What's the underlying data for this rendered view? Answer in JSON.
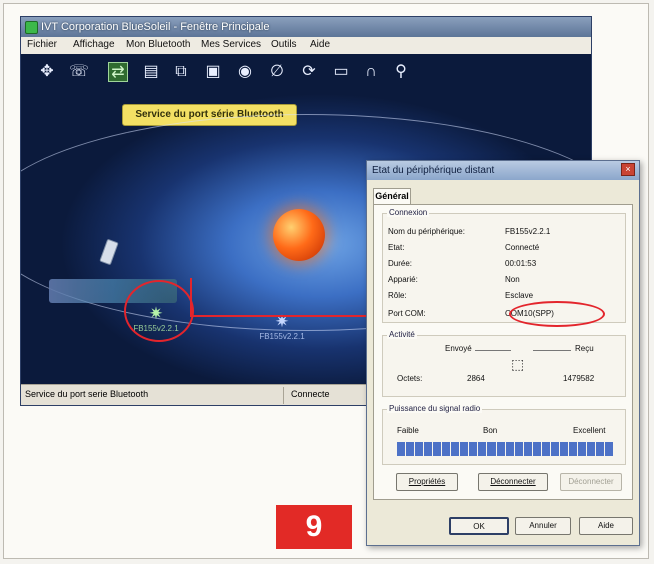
{
  "main_window": {
    "title": "IVT Corporation BlueSoleil - Fenêtre Principale",
    "menu": [
      "Fichier",
      "Affichage",
      "Mon Bluetooth",
      "Mes Services",
      "Outils",
      "Aide"
    ],
    "toolbar_icons": [
      "network-icon",
      "headset-icon",
      "serial-port-icon",
      "file-transfer-icon",
      "dialup-icon",
      "printer-icon",
      "camera-icon",
      "hid-icon",
      "sync-icon",
      "pim-icon",
      "audio-icon",
      "search-icon"
    ],
    "toolbar_active_index": 2,
    "tooltip": "Service du port série Bluetooth",
    "devices": [
      {
        "label": "FB155v2.2.1"
      },
      {
        "label": "FB155v2.2.1"
      }
    ],
    "status": {
      "left": "Service du port serie Bluetooth",
      "right": "Connecte"
    }
  },
  "dialog": {
    "title": "Etat du périphérique distant",
    "close_label": "×",
    "tab": "Général",
    "connexion": {
      "label": "Connexion",
      "rows": [
        {
          "key": "Nom du périphérique:",
          "value": "FB155v2.2.1"
        },
        {
          "key": "Etat:",
          "value": "Connecté"
        },
        {
          "key": "Durée:",
          "value": "00:01:53"
        },
        {
          "key": "Apparié:",
          "value": "Non"
        },
        {
          "key": "Rôle:",
          "value": "Esclave"
        },
        {
          "key": "Port COM:",
          "value": "COM10(SPP)"
        }
      ]
    },
    "activite": {
      "label": "Activité",
      "sent_label": "Envoyé",
      "recv_label": "Reçu",
      "octets_label": "Octets:",
      "sent_value": "2864",
      "recv_value": "1479582"
    },
    "signal": {
      "label": "Puissance du signal radio",
      "low": "Faible",
      "mid": "Bon",
      "high": "Excellent",
      "level": 1.0
    },
    "actions": {
      "properties": "Propriétés",
      "disconnect": "Déconnecter",
      "reconnect": "Déconnecter"
    },
    "buttons": {
      "ok": "OK",
      "cancel": "Annuler",
      "help": "Aide"
    }
  },
  "badge": "9",
  "accent_red": "#e3252c"
}
